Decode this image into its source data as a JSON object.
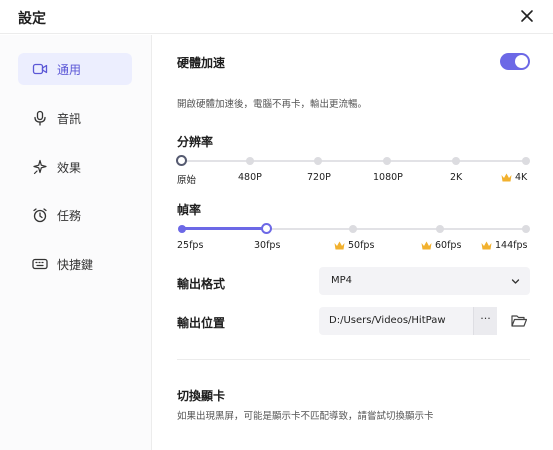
{
  "window": {
    "title": "設定"
  },
  "sidebar": {
    "items": [
      {
        "label": "通用",
        "icon": "camera-icon",
        "active": true
      },
      {
        "label": "音訊",
        "icon": "microphone-icon",
        "active": false
      },
      {
        "label": "效果",
        "icon": "sparkle-icon",
        "active": false
      },
      {
        "label": "任務",
        "icon": "alarm-clock-icon",
        "active": false
      },
      {
        "label": "快捷鍵",
        "icon": "keyboard-icon",
        "active": false
      }
    ]
  },
  "hw_accel": {
    "label": "硬體加速",
    "enabled": true,
    "description": "開啟硬體加速後，電腦不再卡，輸出更流暢。"
  },
  "resolution": {
    "label": "分辨率",
    "options": [
      "原始",
      "480P",
      "720P",
      "1080P",
      "2K",
      "4K"
    ],
    "premium": [
      false,
      false,
      false,
      false,
      false,
      true
    ],
    "selected_index": 0
  },
  "framerate": {
    "label": "幀率",
    "options": [
      "25fps",
      "30fps",
      "50fps",
      "60fps",
      "144fps"
    ],
    "premium": [
      false,
      false,
      true,
      true,
      true
    ],
    "selected_index": 1
  },
  "output_format": {
    "label": "輸出格式",
    "value": "MP4"
  },
  "output_location": {
    "label": "輸出位置",
    "value": "D:/Users/Videos/HitPaw",
    "browse_label": "···"
  },
  "gpu_switch": {
    "label": "切換顯卡",
    "description": "如果出現黑屏，可能是顯示卡不匹配導致，請嘗試切換顯示卡"
  },
  "colors": {
    "accent": "#6c68e6",
    "active_bg": "#eceefe",
    "track": "#e2e2e6"
  }
}
